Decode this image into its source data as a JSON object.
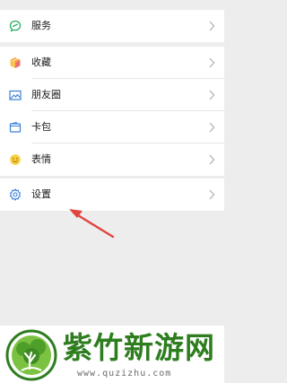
{
  "menu": {
    "services": "服务",
    "favorites": "收藏",
    "moments": "朋友圈",
    "cards": "卡包",
    "stickers": "表情",
    "settings": "设置"
  },
  "watermark": {
    "title": "紫竹新游网",
    "url": "www.quzizhu.com"
  },
  "colors": {
    "background": "#ededed",
    "arrow": "#e0463d",
    "watermark_green": "#2e7d1f"
  }
}
